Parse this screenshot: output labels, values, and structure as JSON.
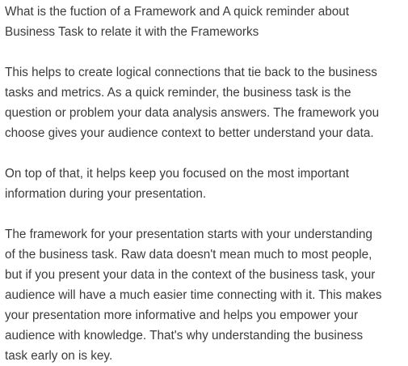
{
  "document": {
    "paragraphs": [
      {
        "lines": [
          "What is the fuction of a Framework and A quick reminder about",
          "Business Task to relate it with the Frameworks"
        ]
      },
      {
        "lines": [
          "This helps to create logical connections that tie back to the business",
          "tasks and metrics. As a quick reminder, the business task is the",
          "question or problem your data analysis answers. The framework you",
          "choose gives your audience context to better understand your data."
        ]
      },
      {
        "lines": [
          "On top of that, it helps keep you focused on the most important",
          "information during your presentation."
        ]
      },
      {
        "lines": [
          "The framework for your presentation starts with your understanding",
          "of the business task. Raw data doesn't mean much to most people,",
          "but if you present your data in the context of the business task, your",
          "audience will have a much easier time connecting with it. This makes",
          "your presentation more informative and helps you empower your",
          "audience with knowledge. That's why understanding the business",
          "task early on is key."
        ]
      }
    ]
  }
}
